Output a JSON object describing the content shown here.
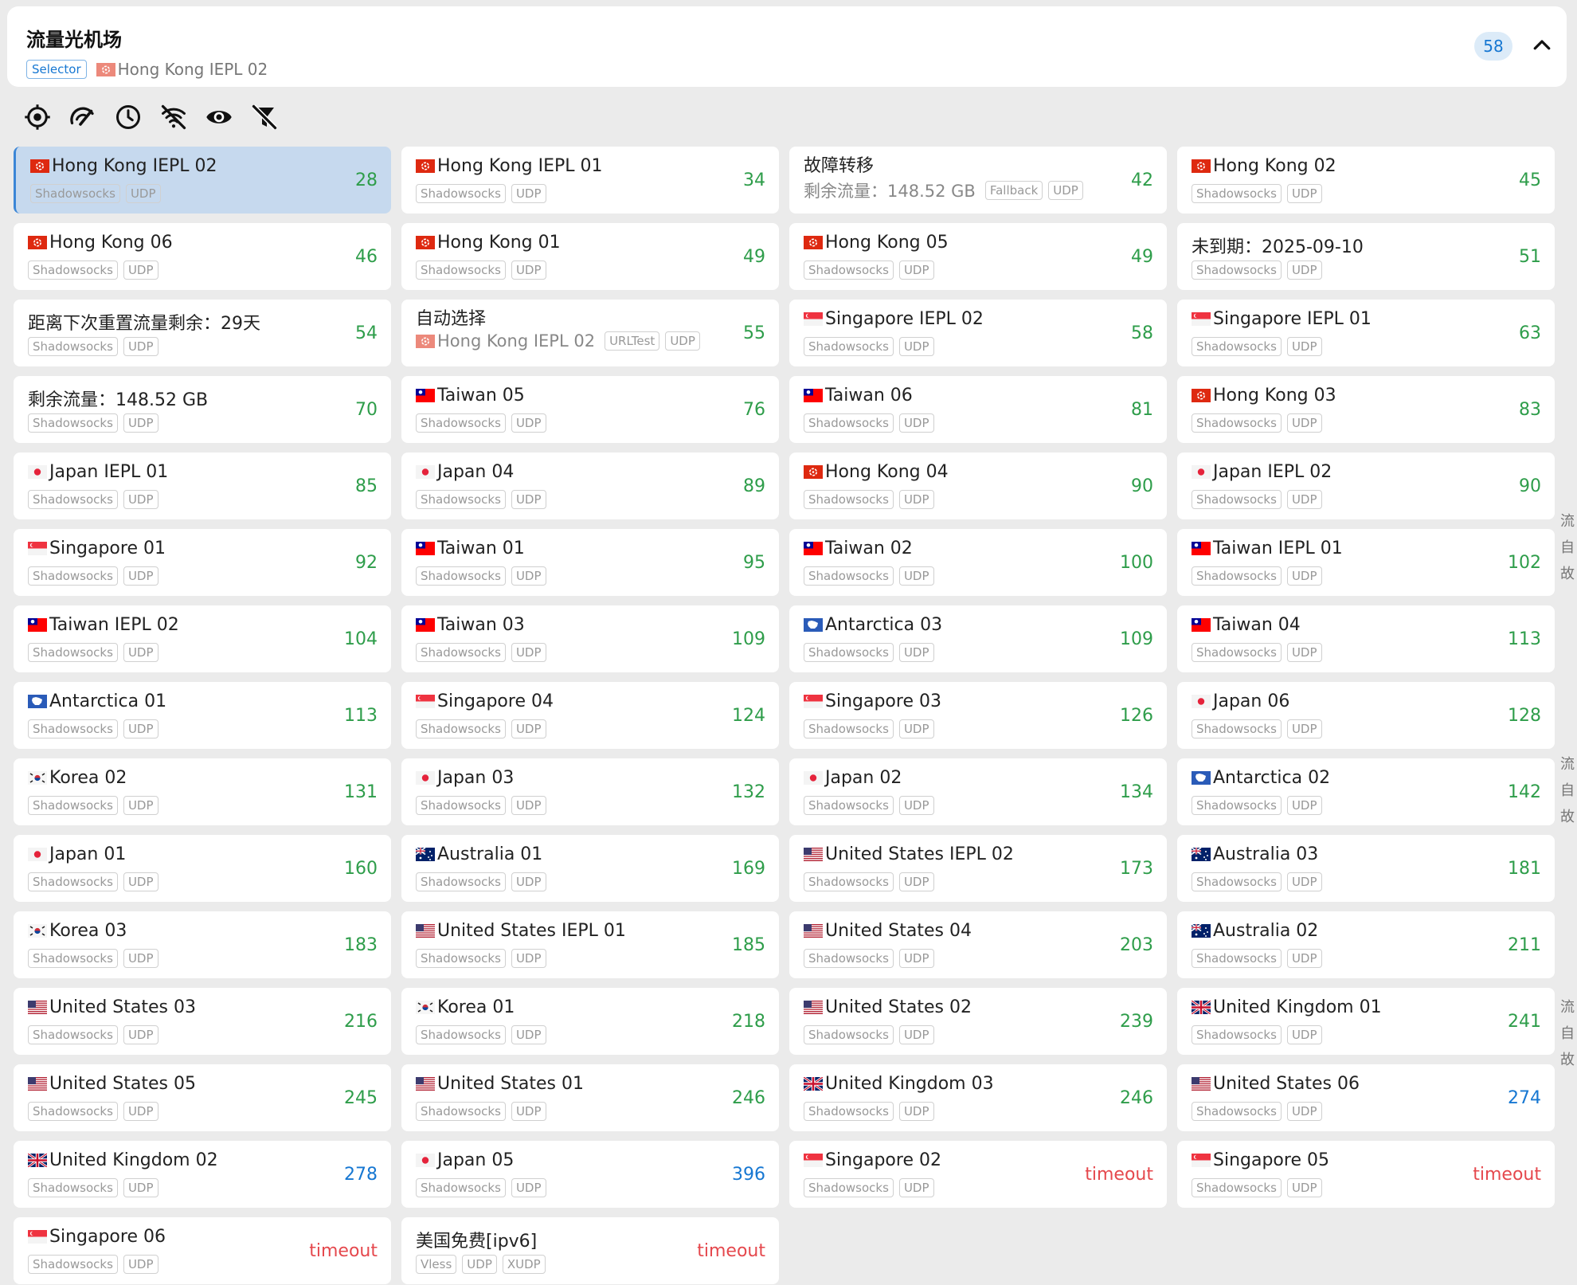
{
  "group": {
    "title": "流量光机场",
    "type_tag": "Selector",
    "now": {
      "flag": "hk",
      "name": "Hong Kong IEPL 02"
    },
    "count": "58",
    "collapse_icon": "chevron-up-icon"
  },
  "toolbar": [
    {
      "name": "locate-icon"
    },
    {
      "name": "speed-test-icon"
    },
    {
      "name": "clock-sort-icon"
    },
    {
      "name": "unavailable-filter-icon"
    },
    {
      "name": "eye-icon"
    },
    {
      "name": "filter-off-icon"
    }
  ],
  "colors": {
    "good": "#2e9d4a",
    "medium": "#1677d2",
    "bad": "#e5484d",
    "accent": "#1677d2",
    "selected_bg": "#c6d9ee"
  },
  "proxies": [
    {
      "name": "Hong Kong IEPL 02",
      "flag": "hk",
      "tags": [
        "Shadowsocks",
        "UDP"
      ],
      "delay": "28",
      "level": "good",
      "selected": true
    },
    {
      "name": "Hong Kong IEPL 01",
      "flag": "hk",
      "tags": [
        "Shadowsocks",
        "UDP"
      ],
      "delay": "34",
      "level": "good"
    },
    {
      "name": "故障转移",
      "flag": "",
      "now": "剩余流量：148.52 GB",
      "now_flag": "",
      "tags": [
        "Fallback",
        "UDP"
      ],
      "delay": "42",
      "level": "good"
    },
    {
      "name": "Hong Kong 02",
      "flag": "hk",
      "tags": [
        "Shadowsocks",
        "UDP"
      ],
      "delay": "45",
      "level": "good"
    },
    {
      "name": "Hong Kong 06",
      "flag": "hk",
      "tags": [
        "Shadowsocks",
        "UDP"
      ],
      "delay": "46",
      "level": "good"
    },
    {
      "name": "Hong Kong 01",
      "flag": "hk",
      "tags": [
        "Shadowsocks",
        "UDP"
      ],
      "delay": "49",
      "level": "good"
    },
    {
      "name": "Hong Kong 05",
      "flag": "hk",
      "tags": [
        "Shadowsocks",
        "UDP"
      ],
      "delay": "49",
      "level": "good"
    },
    {
      "name": "未到期：2025-09-10",
      "flag": "",
      "tags": [
        "Shadowsocks",
        "UDP"
      ],
      "delay": "51",
      "level": "good"
    },
    {
      "name": "距离下次重置流量剩余：29天",
      "flag": "",
      "tags": [
        "Shadowsocks",
        "UDP"
      ],
      "delay": "54",
      "level": "good"
    },
    {
      "name": "自动选择",
      "flag": "",
      "now": "Hong Kong IEPL 02",
      "now_flag": "hk",
      "tags": [
        "URLTest",
        "UDP"
      ],
      "delay": "55",
      "level": "good"
    },
    {
      "name": "Singapore IEPL 02",
      "flag": "sg",
      "tags": [
        "Shadowsocks",
        "UDP"
      ],
      "delay": "58",
      "level": "good"
    },
    {
      "name": "Singapore IEPL 01",
      "flag": "sg",
      "tags": [
        "Shadowsocks",
        "UDP"
      ],
      "delay": "63",
      "level": "good"
    },
    {
      "name": "剩余流量：148.52 GB",
      "flag": "",
      "tags": [
        "Shadowsocks",
        "UDP"
      ],
      "delay": "70",
      "level": "good"
    },
    {
      "name": "Taiwan 05",
      "flag": "tw",
      "tags": [
        "Shadowsocks",
        "UDP"
      ],
      "delay": "76",
      "level": "good"
    },
    {
      "name": "Taiwan 06",
      "flag": "tw",
      "tags": [
        "Shadowsocks",
        "UDP"
      ],
      "delay": "81",
      "level": "good"
    },
    {
      "name": "Hong Kong 03",
      "flag": "hk",
      "tags": [
        "Shadowsocks",
        "UDP"
      ],
      "delay": "83",
      "level": "good"
    },
    {
      "name": "Japan IEPL 01",
      "flag": "jp",
      "tags": [
        "Shadowsocks",
        "UDP"
      ],
      "delay": "85",
      "level": "good"
    },
    {
      "name": "Japan 04",
      "flag": "jp",
      "tags": [
        "Shadowsocks",
        "UDP"
      ],
      "delay": "89",
      "level": "good"
    },
    {
      "name": "Hong Kong 04",
      "flag": "hk",
      "tags": [
        "Shadowsocks",
        "UDP"
      ],
      "delay": "90",
      "level": "good"
    },
    {
      "name": "Japan IEPL 02",
      "flag": "jp",
      "tags": [
        "Shadowsocks",
        "UDP"
      ],
      "delay": "90",
      "level": "good"
    },
    {
      "name": "Singapore 01",
      "flag": "sg",
      "tags": [
        "Shadowsocks",
        "UDP"
      ],
      "delay": "92",
      "level": "good"
    },
    {
      "name": "Taiwan 01",
      "flag": "tw",
      "tags": [
        "Shadowsocks",
        "UDP"
      ],
      "delay": "95",
      "level": "good"
    },
    {
      "name": "Taiwan 02",
      "flag": "tw",
      "tags": [
        "Shadowsocks",
        "UDP"
      ],
      "delay": "100",
      "level": "good"
    },
    {
      "name": "Taiwan IEPL 01",
      "flag": "tw",
      "tags": [
        "Shadowsocks",
        "UDP"
      ],
      "delay": "102",
      "level": "good"
    },
    {
      "name": "Taiwan IEPL 02",
      "flag": "tw",
      "tags": [
        "Shadowsocks",
        "UDP"
      ],
      "delay": "104",
      "level": "good"
    },
    {
      "name": "Taiwan 03",
      "flag": "tw",
      "tags": [
        "Shadowsocks",
        "UDP"
      ],
      "delay": "109",
      "level": "good"
    },
    {
      "name": "Antarctica 03",
      "flag": "aq",
      "tags": [
        "Shadowsocks",
        "UDP"
      ],
      "delay": "109",
      "level": "good"
    },
    {
      "name": "Taiwan 04",
      "flag": "tw",
      "tags": [
        "Shadowsocks",
        "UDP"
      ],
      "delay": "113",
      "level": "good"
    },
    {
      "name": "Antarctica 01",
      "flag": "aq",
      "tags": [
        "Shadowsocks",
        "UDP"
      ],
      "delay": "113",
      "level": "good"
    },
    {
      "name": "Singapore 04",
      "flag": "sg",
      "tags": [
        "Shadowsocks",
        "UDP"
      ],
      "delay": "124",
      "level": "good"
    },
    {
      "name": "Singapore 03",
      "flag": "sg",
      "tags": [
        "Shadowsocks",
        "UDP"
      ],
      "delay": "126",
      "level": "good"
    },
    {
      "name": "Japan 06",
      "flag": "jp",
      "tags": [
        "Shadowsocks",
        "UDP"
      ],
      "delay": "128",
      "level": "good"
    },
    {
      "name": "Korea 02",
      "flag": "kr",
      "tags": [
        "Shadowsocks",
        "UDP"
      ],
      "delay": "131",
      "level": "good"
    },
    {
      "name": "Japan 03",
      "flag": "jp",
      "tags": [
        "Shadowsocks",
        "UDP"
      ],
      "delay": "132",
      "level": "good"
    },
    {
      "name": "Japan 02",
      "flag": "jp",
      "tags": [
        "Shadowsocks",
        "UDP"
      ],
      "delay": "134",
      "level": "good"
    },
    {
      "name": "Antarctica 02",
      "flag": "aq",
      "tags": [
        "Shadowsocks",
        "UDP"
      ],
      "delay": "142",
      "level": "good"
    },
    {
      "name": "Japan 01",
      "flag": "jp",
      "tags": [
        "Shadowsocks",
        "UDP"
      ],
      "delay": "160",
      "level": "good"
    },
    {
      "name": "Australia 01",
      "flag": "au",
      "tags": [
        "Shadowsocks",
        "UDP"
      ],
      "delay": "169",
      "level": "good"
    },
    {
      "name": "United States IEPL 02",
      "flag": "us",
      "tags": [
        "Shadowsocks",
        "UDP"
      ],
      "delay": "173",
      "level": "good"
    },
    {
      "name": "Australia 03",
      "flag": "au",
      "tags": [
        "Shadowsocks",
        "UDP"
      ],
      "delay": "181",
      "level": "good"
    },
    {
      "name": "Korea 03",
      "flag": "kr",
      "tags": [
        "Shadowsocks",
        "UDP"
      ],
      "delay": "183",
      "level": "good"
    },
    {
      "name": "United States IEPL 01",
      "flag": "us",
      "tags": [
        "Shadowsocks",
        "UDP"
      ],
      "delay": "185",
      "level": "good"
    },
    {
      "name": "United States 04",
      "flag": "us",
      "tags": [
        "Shadowsocks",
        "UDP"
      ],
      "delay": "203",
      "level": "good"
    },
    {
      "name": "Australia 02",
      "flag": "au",
      "tags": [
        "Shadowsocks",
        "UDP"
      ],
      "delay": "211",
      "level": "good"
    },
    {
      "name": "United States 03",
      "flag": "us",
      "tags": [
        "Shadowsocks",
        "UDP"
      ],
      "delay": "216",
      "level": "good"
    },
    {
      "name": "Korea 01",
      "flag": "kr",
      "tags": [
        "Shadowsocks",
        "UDP"
      ],
      "delay": "218",
      "level": "good"
    },
    {
      "name": "United States 02",
      "flag": "us",
      "tags": [
        "Shadowsocks",
        "UDP"
      ],
      "delay": "239",
      "level": "good"
    },
    {
      "name": "United Kingdom 01",
      "flag": "gb",
      "tags": [
        "Shadowsocks",
        "UDP"
      ],
      "delay": "241",
      "level": "good"
    },
    {
      "name": "United States 05",
      "flag": "us",
      "tags": [
        "Shadowsocks",
        "UDP"
      ],
      "delay": "245",
      "level": "good"
    },
    {
      "name": "United States 01",
      "flag": "us",
      "tags": [
        "Shadowsocks",
        "UDP"
      ],
      "delay": "246",
      "level": "good"
    },
    {
      "name": "United Kingdom 03",
      "flag": "gb",
      "tags": [
        "Shadowsocks",
        "UDP"
      ],
      "delay": "246",
      "level": "good"
    },
    {
      "name": "United States 06",
      "flag": "us",
      "tags": [
        "Shadowsocks",
        "UDP"
      ],
      "delay": "274",
      "level": "medium"
    },
    {
      "name": "United Kingdom 02",
      "flag": "gb",
      "tags": [
        "Shadowsocks",
        "UDP"
      ],
      "delay": "278",
      "level": "medium"
    },
    {
      "name": "Japan 05",
      "flag": "jp",
      "tags": [
        "Shadowsocks",
        "UDP"
      ],
      "delay": "396",
      "level": "medium"
    },
    {
      "name": "Singapore 02",
      "flag": "sg",
      "tags": [
        "Shadowsocks",
        "UDP"
      ],
      "delay": "timeout",
      "level": "bad"
    },
    {
      "name": "Singapore 05",
      "flag": "sg",
      "tags": [
        "Shadowsocks",
        "UDP"
      ],
      "delay": "timeout",
      "level": "bad"
    },
    {
      "name": "Singapore 06",
      "flag": "sg",
      "tags": [
        "Shadowsocks",
        "UDP"
      ],
      "delay": "timeout",
      "level": "bad"
    },
    {
      "name": "美国免费[ipv6]",
      "flag": "",
      "tags": [
        "Vless",
        "UDP",
        "XUDP"
      ],
      "delay": "timeout",
      "level": "bad"
    }
  ],
  "side_rail": [
    "流",
    "自",
    "故",
    "流",
    "自",
    "故",
    "流",
    "自",
    "故"
  ]
}
